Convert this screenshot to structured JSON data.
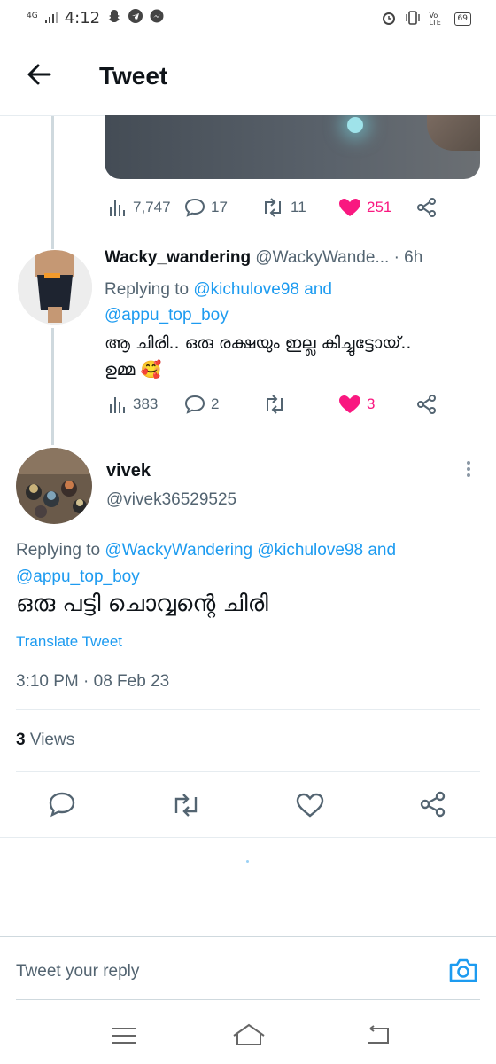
{
  "status_bar": {
    "network": "4G",
    "time": "4:12",
    "volte": "Vo LTE",
    "battery": "69"
  },
  "header": {
    "title": "Tweet"
  },
  "parent_tweet": {
    "stats": {
      "views": "7,747",
      "replies": "17",
      "retweets": "11",
      "likes": "251"
    }
  },
  "reply_tweet": {
    "display_name": "Wacky_wandering",
    "handle": "@WackyWande...",
    "time": "· 6h",
    "replying_prefix": "Replying to",
    "replying_user1": "@kichulove98",
    "replying_and": "and",
    "replying_user2": "@appu_top_boy",
    "text_line1": "ആ ചിരി.. ഒരു രക്ഷയും ഇല്ല കിച്ചുട്ടോയ്..",
    "text_line2": "ഉമ്മ 🥰",
    "stats": {
      "views": "383",
      "replies": "2",
      "retweets": "",
      "likes": "3"
    }
  },
  "main_tweet": {
    "display_name": "vivek",
    "handle": "@vivek36529525",
    "replying_prefix": "Replying to",
    "replying_user1": "@WackyWandering",
    "replying_user2": "@kichulove98",
    "replying_and": "and",
    "replying_user3": "@appu_top_boy",
    "text": "ഒരു പട്ടി ചൊവ്വന്റെ ചിരി",
    "translate": "Translate Tweet",
    "timestamp": "3:10 PM · 08 Feb 23",
    "views_count": "3",
    "views_label": "Views"
  },
  "reply_input": {
    "placeholder": "Tweet your reply"
  },
  "colors": {
    "accent": "#1d9bf0",
    "like": "#f91880",
    "muted": "#536471"
  }
}
